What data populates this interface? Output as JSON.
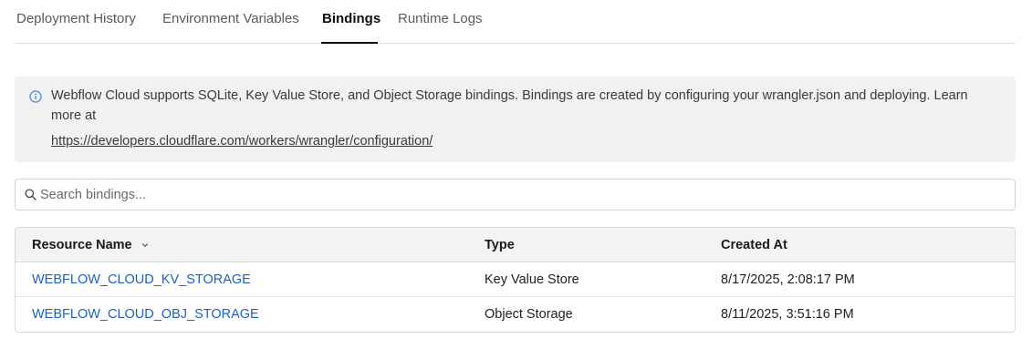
{
  "tabs": [
    {
      "label": "Deployment History",
      "active": false
    },
    {
      "label": "Environment Variables",
      "active": false
    },
    {
      "label": "Bindings",
      "active": true
    },
    {
      "label": "Runtime Logs",
      "active": false
    }
  ],
  "notice": {
    "text": "Webflow Cloud supports SQLite, Key Value Store, and Object Storage bindings. Bindings are created by configuring your wrangler.json and deploying. Learn more at",
    "link": "https://developers.cloudflare.com/workers/wrangler/configuration/",
    "icon": "info-icon"
  },
  "search": {
    "placeholder": "Search bindings...",
    "value": ""
  },
  "table": {
    "headers": {
      "resource_name": "Resource Name",
      "type": "Type",
      "created_at": "Created At"
    },
    "rows": [
      {
        "resource_name": "WEBFLOW_CLOUD_KV_STORAGE",
        "type": "Key Value Store",
        "created_at": "8/17/2025, 2:08:17 PM"
      },
      {
        "resource_name": "WEBFLOW_CLOUD_OBJ_STORAGE",
        "type": "Object Storage",
        "created_at": "8/11/2025, 3:51:16 PM"
      }
    ]
  },
  "colors": {
    "link": "#1b5fd1",
    "notice_bg": "#f1f1f1",
    "header_bg": "#f3f3f3",
    "info_icon": "#3d7fe0"
  }
}
